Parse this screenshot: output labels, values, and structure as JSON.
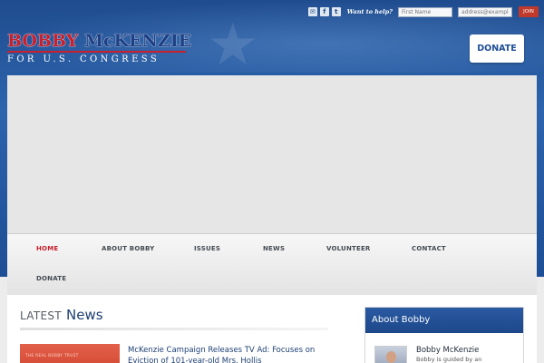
{
  "topbar": {
    "social_icons": [
      {
        "name": "email-icon",
        "glyph": "✉"
      },
      {
        "name": "facebook-icon",
        "glyph": "f"
      },
      {
        "name": "twitter-icon",
        "glyph": "t"
      }
    ],
    "help_text": "Want to help?",
    "first_name_placeholder": "First Name",
    "email_placeholder": "address@example",
    "join_label": "JOIN"
  },
  "logo": {
    "first": "BOBBY",
    "last": "McKENZIE",
    "subtitle": "FOR U.S. CONGRESS"
  },
  "header": {
    "donate_label": "DONATE"
  },
  "nav": {
    "items": [
      {
        "label": "HOME",
        "active": true
      },
      {
        "label": "ABOUT BOBBY"
      },
      {
        "label": "ISSUES"
      },
      {
        "label": "NEWS"
      },
      {
        "label": "VOLUNTEER"
      },
      {
        "label": "CONTACT"
      },
      {
        "label": "DONATE"
      }
    ]
  },
  "news": {
    "latest_word": "LATEST",
    "news_word": "News",
    "thumb_text": "THE REAL BOBBY TRUST",
    "first_article_title": "McKenzie Campaign Releases TV Ad: Focuses on Eviction of 101-year-old Mrs. Hollis"
  },
  "about": {
    "heading": "About Bobby",
    "name": "Bobby McKenzie",
    "text": "Bobby is guided by an"
  },
  "colors": {
    "brand_blue": "#1d4d95",
    "brand_red": "#c8202f",
    "active_nav": "#c8202f"
  }
}
